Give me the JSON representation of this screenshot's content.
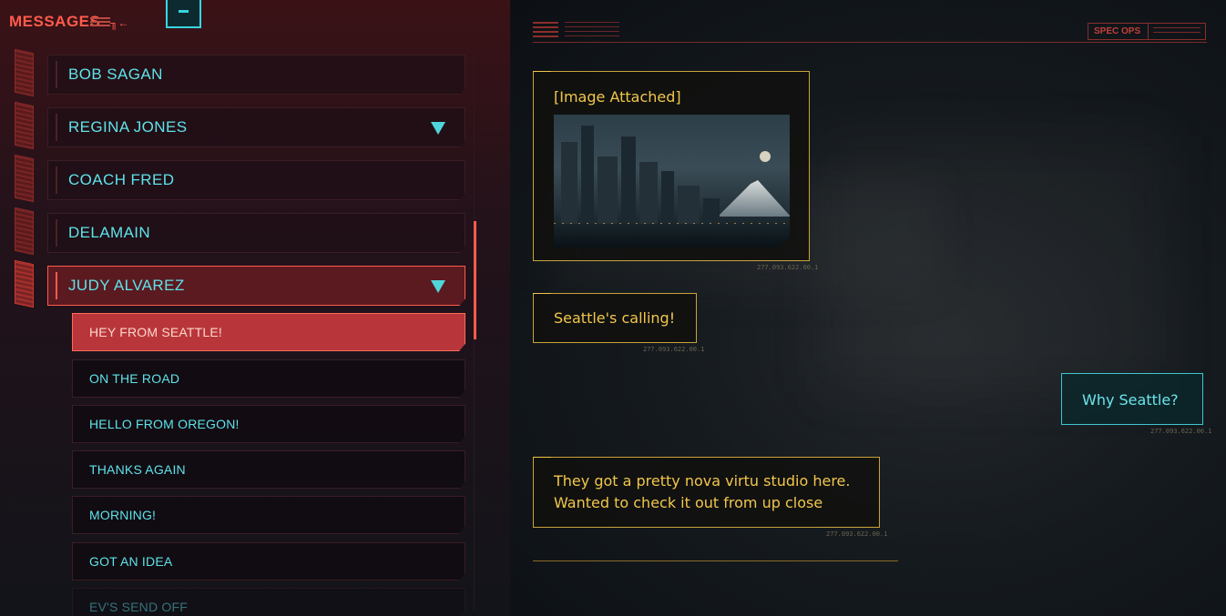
{
  "app": {
    "title": "MESSAGES"
  },
  "contacts": [
    {
      "name": "BOB SAGAN",
      "expanded": false,
      "active": false
    },
    {
      "name": "REGINA JONES",
      "expanded": true,
      "active": false
    },
    {
      "name": "COACH FRED",
      "expanded": false,
      "active": false
    },
    {
      "name": "DELAMAIN",
      "expanded": false,
      "active": false
    },
    {
      "name": "JUDY ALVAREZ",
      "expanded": true,
      "active": true
    }
  ],
  "threads": [
    {
      "label": "HEY FROM SEATTLE!",
      "active": true
    },
    {
      "label": "ON THE ROAD",
      "active": false
    },
    {
      "label": "HELLO FROM OREGON!",
      "active": false
    },
    {
      "label": "THANKS AGAIN",
      "active": false
    },
    {
      "label": "MORNING!",
      "active": false
    },
    {
      "label": "GOT AN IDEA",
      "active": false
    },
    {
      "label": "EV'S SEND OFF",
      "active": false
    }
  ],
  "chat_header": {
    "spec_ops": "SPEC OPS"
  },
  "messages": [
    {
      "sender": "them",
      "text": "[Image Attached]",
      "attachment": "image-seattle-skyline",
      "timestamp": "277.093.622.00.1"
    },
    {
      "sender": "them",
      "text": "Seattle's calling!",
      "timestamp": "277.093.622.00.1"
    },
    {
      "sender": "me",
      "text": "Why Seattle?",
      "timestamp": "277.093.622.00.1"
    },
    {
      "sender": "them",
      "text_lines": [
        "They got a pretty nova virtu studio here.",
        "Wanted to check it out from up close"
      ],
      "timestamp": "277.093.622.00.1"
    }
  ],
  "colors": {
    "accent_red": "#ff5b4c",
    "accent_cyan": "#5fe3ea",
    "message_gold": "#f2c64c",
    "active_thread": "#b8363a"
  }
}
